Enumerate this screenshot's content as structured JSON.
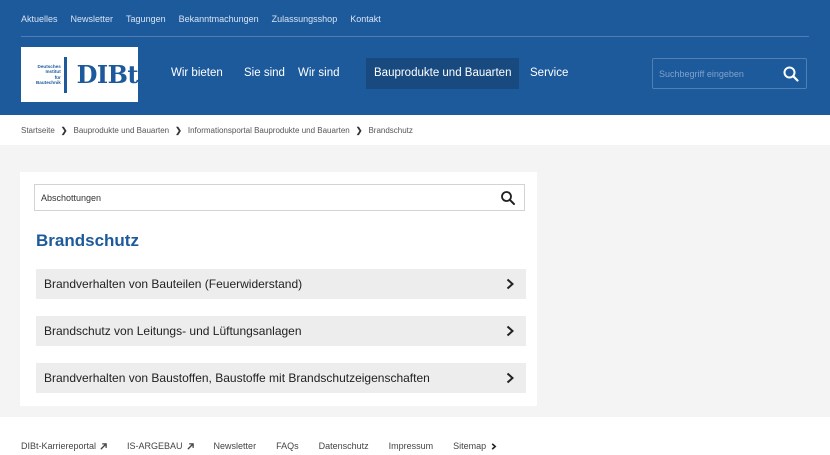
{
  "topnav": [
    "Aktuelles",
    "Newsletter",
    "Tagungen",
    "Bekanntmachungen",
    "Zulassungsshop",
    "Kontakt"
  ],
  "logo": {
    "small_lines": [
      "Deutsches",
      "Institut",
      "für",
      "Bautechnik"
    ],
    "big": "DIBt"
  },
  "mainnav": [
    "Wir bieten",
    "Sie sind",
    "Wir sind",
    "Bauprodukte und Bauarten",
    "Service"
  ],
  "header_search": {
    "placeholder": "Suchbegriff eingeben"
  },
  "breadcrumb": [
    "Startseite",
    "Bauprodukte und Bauarten",
    "Informationsportal Bauprodukte und Bauarten",
    "Brandschutz"
  ],
  "content_search": {
    "value": "Abschottungen"
  },
  "page_title": "Brandschutz",
  "accordion": [
    "Brandverhalten von Bauteilen (Feuerwiderstand)",
    "Brandschutz von Leitungs- und Lüftungsanlagen",
    "Brandverhalten von Baustoffen, Baustoffe mit Brandschutzeigenschaften"
  ],
  "footer": {
    "links": [
      "DIBt-Karriereportal",
      "IS-ARGEBAU",
      "Newsletter",
      "FAQs",
      "Datenschutz",
      "Impressum",
      "Sitemap"
    ]
  },
  "colors": {
    "brand_blue": "#1d5a9c",
    "active_nav": "#184a80",
    "panel_gray": "#f4f4f4"
  }
}
